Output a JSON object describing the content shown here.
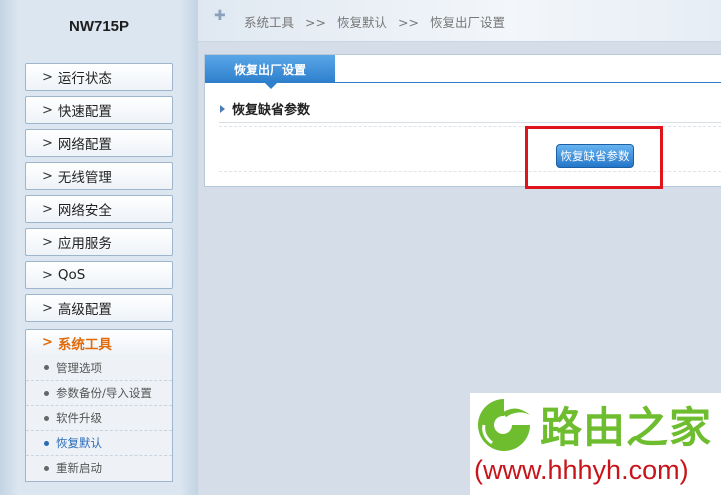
{
  "sidebar": {
    "device_name": "NW715P",
    "menu": [
      {
        "label": "运行状态"
      },
      {
        "label": "快速配置"
      },
      {
        "label": "网络配置"
      },
      {
        "label": "无线管理"
      },
      {
        "label": "网络安全"
      },
      {
        "label": "应用服务"
      },
      {
        "label": "QoS"
      },
      {
        "label": "高级配置"
      },
      {
        "label": "系统工具",
        "active": true
      }
    ],
    "submenu": [
      {
        "label": "管理选项"
      },
      {
        "label": "参数备份/导入设置"
      },
      {
        "label": "软件升级"
      },
      {
        "label": "恢复默认",
        "current": true
      },
      {
        "label": "重新启动"
      }
    ]
  },
  "breadcrumb": {
    "icon": "plus-icon",
    "items": [
      "系统工具",
      "恢复默认",
      "恢复出厂设置"
    ],
    "separator": ">>"
  },
  "panel": {
    "tab_label": "恢复出厂设置",
    "section_title": "恢复缺省参数",
    "button_label": "恢复缺省参数"
  },
  "watermark": {
    "name": "路由之家",
    "url": "(www.hhhyh.com)"
  },
  "colors": {
    "accent_blue": "#2d7fcc",
    "active_orange": "#e06b0c",
    "highlight_red": "#e0141b",
    "watermark_green": "#6ebd2f",
    "watermark_red": "#c8151b"
  }
}
